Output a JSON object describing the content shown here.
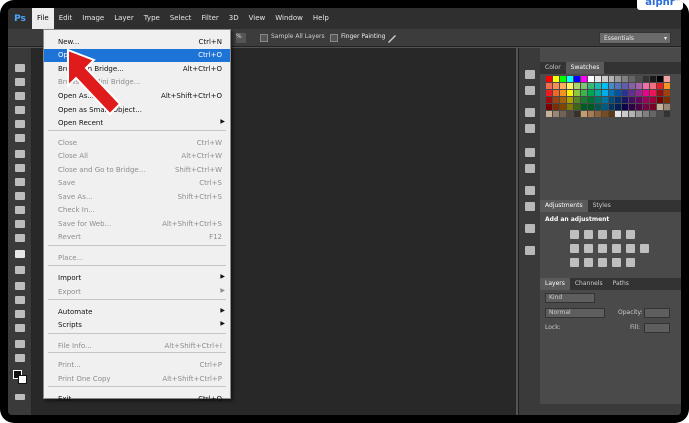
{
  "app": {
    "logo": "Ps",
    "brand": "alphr"
  },
  "menubar": [
    "File",
    "Edit",
    "Image",
    "Layer",
    "Type",
    "Select",
    "Filter",
    "3D",
    "View",
    "Window",
    "Help"
  ],
  "options": {
    "percent": "%",
    "sample_all_layers": "Sample All Layers",
    "finger_painting": "Finger Painting",
    "workspace": "Essentials"
  },
  "file_menu": [
    {
      "label": "New...",
      "shortcut": "Ctrl+N",
      "state": "normal"
    },
    {
      "label": "Open...",
      "shortcut": "Ctrl+O",
      "state": "highlighted"
    },
    {
      "label": "Browse in Bridge...",
      "shortcut": "Alt+Ctrl+O",
      "state": "normal"
    },
    {
      "label": "Browse in Mini Bridge...",
      "shortcut": "",
      "state": "disabled"
    },
    {
      "label": "Open As...",
      "shortcut": "Alt+Shift+Ctrl+O",
      "state": "normal"
    },
    {
      "label": "Open as Smart Object...",
      "shortcut": "",
      "state": "normal"
    },
    {
      "label": "Open Recent",
      "shortcut": "",
      "state": "submenu"
    },
    {
      "label": "Close",
      "shortcut": "Ctrl+W",
      "state": "disabled"
    },
    {
      "label": "Close All",
      "shortcut": "Alt+Ctrl+W",
      "state": "disabled"
    },
    {
      "label": "Close and Go to Bridge...",
      "shortcut": "Shift+Ctrl+W",
      "state": "disabled"
    },
    {
      "label": "Save",
      "shortcut": "Ctrl+S",
      "state": "disabled"
    },
    {
      "label": "Save As...",
      "shortcut": "Shift+Ctrl+S",
      "state": "disabled"
    },
    {
      "label": "Check In...",
      "shortcut": "",
      "state": "disabled"
    },
    {
      "label": "Save for Web...",
      "shortcut": "Alt+Shift+Ctrl+S",
      "state": "disabled"
    },
    {
      "label": "Revert",
      "shortcut": "F12",
      "state": "disabled"
    },
    {
      "label": "Place...",
      "shortcut": "",
      "state": "disabled"
    },
    {
      "label": "Import",
      "shortcut": "",
      "state": "submenu"
    },
    {
      "label": "Export",
      "shortcut": "",
      "state": "disabled-submenu"
    },
    {
      "label": "Automate",
      "shortcut": "",
      "state": "submenu"
    },
    {
      "label": "Scripts",
      "shortcut": "",
      "state": "submenu"
    },
    {
      "label": "File Info...",
      "shortcut": "Alt+Shift+Ctrl+I",
      "state": "disabled"
    },
    {
      "label": "Print...",
      "shortcut": "Ctrl+P",
      "state": "disabled"
    },
    {
      "label": "Print One Copy",
      "shortcut": "Alt+Shift+Ctrl+P",
      "state": "disabled"
    },
    {
      "label": "Exit",
      "shortcut": "Ctrl+Q",
      "state": "normal"
    }
  ],
  "panels": {
    "color_tabs": [
      "Color",
      "Swatches"
    ],
    "adjust_tabs": [
      "Adjustments",
      "Styles"
    ],
    "add_adjustment": "Add an adjustment",
    "layers_tabs": [
      "Layers",
      "Channels",
      "Paths"
    ],
    "kind": "Kind",
    "blend_mode": "Normal",
    "opacity_label": "Opacity:",
    "lock_label": "Lock:",
    "fill_label": "Fill:"
  },
  "colors": {
    "highlight": "#1e73d6",
    "arrow": "#e01b1b"
  }
}
